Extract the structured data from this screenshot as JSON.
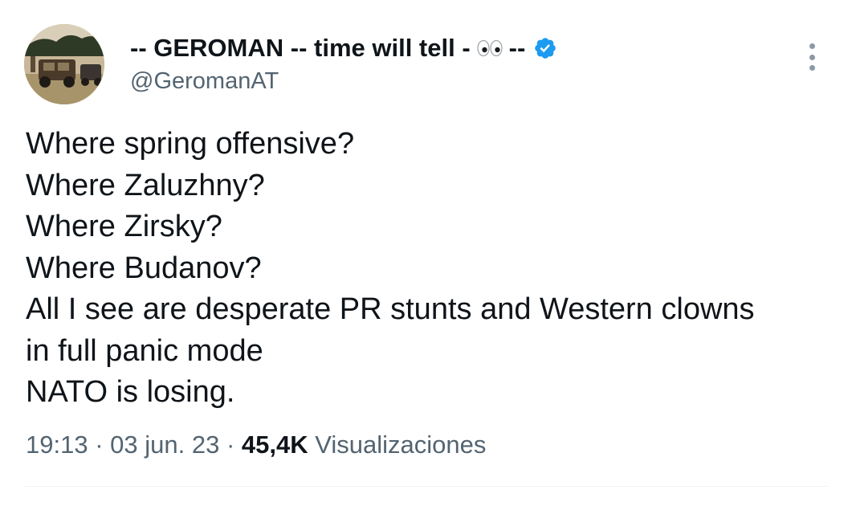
{
  "author": {
    "display_name_prefix": "-- GEROMAN -- time will tell -",
    "display_name_suffix": "--",
    "emoji_icon": "eyes-emoji",
    "handle": "@GeromanAT",
    "verified": true,
    "verified_color": "#1d9bf0"
  },
  "tweet": {
    "lines": [
      "Where spring offensive?",
      "Where Zaluzhny?",
      "Where Zirsky?",
      "Where Budanov?",
      "All I see are desperate PR stunts and Western clowns",
      "in full panic mode",
      "NATO is losing."
    ]
  },
  "meta": {
    "time": "19:13",
    "separator": "·",
    "date": "03 jun. 23",
    "views_count": "45,4K",
    "views_label": "Visualizaciones"
  },
  "colors": {
    "text_primary": "#0f1419",
    "text_secondary": "#536471",
    "divider": "#eff3f4"
  }
}
